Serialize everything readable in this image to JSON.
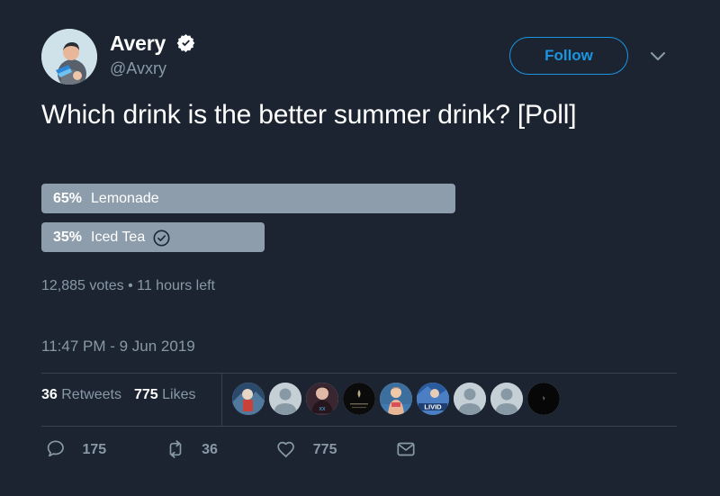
{
  "theme": {
    "background": "#1b2430",
    "text_primary": "#ffffff",
    "text_muted": "#8899a6",
    "accent": "#1b95e0",
    "poll_bar": "#8d9dab",
    "divider": "#38444d"
  },
  "account": {
    "display_name": "Avery",
    "handle": "@Avxry",
    "verified_icon": "verified-badge-icon",
    "avatar_icon": "user-avatar-image"
  },
  "header": {
    "follow_label": "Follow",
    "caret_icon": "chevron-down-icon"
  },
  "tweet": {
    "text": "Which drink is the better summer drink? [Poll]"
  },
  "poll": {
    "options": [
      {
        "percent_label": "65%",
        "option_label": "Lemonade",
        "percent_value": 65,
        "voted": false
      },
      {
        "percent_label": "35%",
        "option_label": "Iced Tea",
        "percent_value": 35,
        "voted": true,
        "voted_icon": "check-circle-icon"
      }
    ],
    "meta": "12,885 votes • 11 hours left",
    "votes_count": "12,885 votes",
    "time_left": "11 hours left"
  },
  "timestamp": "11:47 PM - 9 Jun 2019",
  "stats": {
    "retweets_count": "36",
    "retweets_label": "Retweets",
    "likes_count": "775",
    "likes_label": "Likes"
  },
  "likers": [
    {
      "name": "liker-avatar-1",
      "type": "photo",
      "bg": "#2b4a6b",
      "fg": "#d8e6f2"
    },
    {
      "name": "liker-avatar-2",
      "type": "default",
      "bg": "#c4cfd6",
      "fg": "#8899a6"
    },
    {
      "name": "liker-avatar-3",
      "type": "photo",
      "bg": "#3a2630",
      "fg": "#e0b9a6"
    },
    {
      "name": "liker-avatar-4",
      "type": "photo",
      "bg": "#0b0b0c",
      "fg": "#b9a98c"
    },
    {
      "name": "liker-avatar-5",
      "type": "photo",
      "bg": "#3d6f9e",
      "fg": "#f0c9a8"
    },
    {
      "name": "liker-avatar-6",
      "type": "photo",
      "bg": "#2a5b9e",
      "fg": "#ffffff"
    },
    {
      "name": "liker-avatar-7",
      "type": "default",
      "bg": "#c4cfd6",
      "fg": "#8899a6"
    },
    {
      "name": "liker-avatar-8",
      "type": "default",
      "bg": "#c4cfd6",
      "fg": "#8899a6"
    },
    {
      "name": "liker-avatar-9",
      "type": "photo",
      "bg": "#070708",
      "fg": "#5a5a5e"
    }
  ],
  "actions": [
    {
      "name": "reply-action",
      "icon": "reply-icon",
      "count": "175"
    },
    {
      "name": "retweet-action",
      "icon": "retweet-icon",
      "count": "36"
    },
    {
      "name": "like-action",
      "icon": "heart-icon",
      "count": "775"
    },
    {
      "name": "share-action",
      "icon": "envelope-icon",
      "count": ""
    }
  ]
}
